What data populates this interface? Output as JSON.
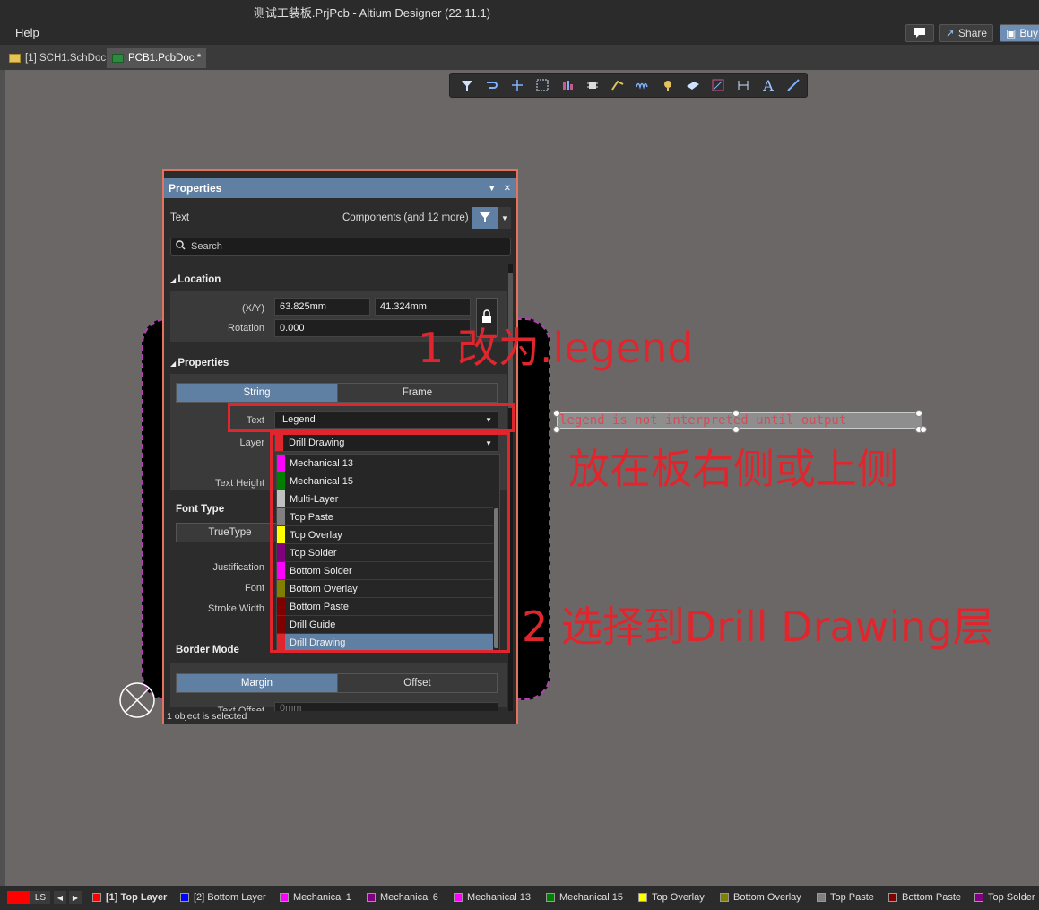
{
  "window": {
    "title": "测试工装板.PrjPcb - Altium Designer (22.11.1)"
  },
  "menu": {
    "help": "Help"
  },
  "topbar": {
    "share": "Share",
    "buy": "Buy"
  },
  "tabs": [
    {
      "label": "[1] SCH1.SchDoc"
    },
    {
      "label": "PCB1.PcbDoc *"
    }
  ],
  "canvas": {
    "legend_text": "legend is not interpreted until output"
  },
  "panel": {
    "title": "Properties",
    "object_type": "Text",
    "filter_label": "Components (and 12 more)",
    "search_placeholder": "Search",
    "location_section": "Location",
    "xy_label": "(X/Y)",
    "x_value": "63.825mm",
    "y_value": "41.324mm",
    "rotation_label": "Rotation",
    "rotation_value": "0.000",
    "properties_section": "Properties",
    "tab_string": "String",
    "tab_frame": "Frame",
    "text_label": "Text",
    "text_value": ".Legend",
    "layer_label": "Layer",
    "layer_value": "Drill Drawing",
    "text_height_label": "Text Height",
    "font_type_label": "Font Type",
    "truetype": "TrueType",
    "justification_label": "Justification",
    "font_label": "Font",
    "stroke_width_label": "Stroke Width",
    "border_mode_label": "Border Mode",
    "margin": "Margin",
    "offset": "Offset",
    "text_offset_label": "Text Offset",
    "text_offset_value": "0mm",
    "status": "1 object is selected"
  },
  "layer_options": [
    {
      "name": "Mechanical 13",
      "color": "#ff00ff"
    },
    {
      "name": "Mechanical 15",
      "color": "#008000"
    },
    {
      "name": "Multi-Layer",
      "color": "#c0c0c0"
    },
    {
      "name": "Top Paste",
      "color": "#808080"
    },
    {
      "name": "Top Overlay",
      "color": "#ffff00"
    },
    {
      "name": "Top Solder",
      "color": "#800080"
    },
    {
      "name": "Bottom Solder",
      "color": "#ff00ff"
    },
    {
      "name": "Bottom Overlay",
      "color": "#808000"
    },
    {
      "name": "Bottom Paste",
      "color": "#800000"
    },
    {
      "name": "Drill Guide",
      "color": "#800000"
    },
    {
      "name": "Drill Drawing",
      "color": "#e0262c"
    }
  ],
  "annotations": {
    "step1": "1  改为.legend",
    "step1b": "放在板右侧或上侧",
    "step2": "2  选择到Drill Drawing层"
  },
  "layers_bar": {
    "ls": "LS",
    "items": [
      {
        "name": "[1] Top Layer",
        "color": "#ff0000"
      },
      {
        "name": "[2] Bottom Layer",
        "color": "#0000ff"
      },
      {
        "name": "Mechanical 1",
        "color": "#ff00ff"
      },
      {
        "name": "Mechanical 6",
        "color": "#800080"
      },
      {
        "name": "Mechanical 13",
        "color": "#ff00ff"
      },
      {
        "name": "Mechanical 15",
        "color": "#008000"
      },
      {
        "name": "Top Overlay",
        "color": "#ffff00"
      },
      {
        "name": "Bottom Overlay",
        "color": "#808000"
      },
      {
        "name": "Top Paste",
        "color": "#808080"
      },
      {
        "name": "Bottom Paste",
        "color": "#800000"
      },
      {
        "name": "Top Solder",
        "color": "#800080"
      }
    ]
  }
}
